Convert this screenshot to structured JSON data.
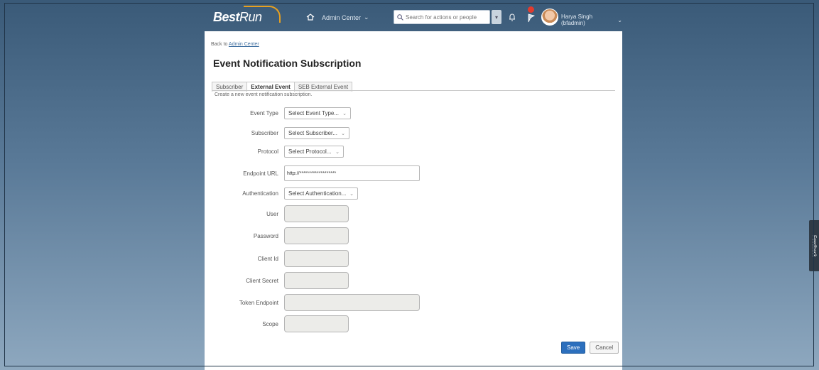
{
  "colors": {
    "primary_button": "#2c6fbd",
    "notification_badge": "#e23b2e",
    "logo_accent": "#e6a020"
  },
  "shell": {
    "logo_best": "Best",
    "logo_run": "Run",
    "nav_label": "Admin Center",
    "search_placeholder": "Search for actions or people",
    "user_name": "Harya Singh (bfadmin)"
  },
  "breadcrumb": {
    "prefix": "Back to",
    "link": "Admin Center"
  },
  "page": {
    "title": "Event Notification Subscription"
  },
  "tabs": [
    {
      "label": "Subscriber"
    },
    {
      "label": "External Event"
    },
    {
      "label": "SEB External Event"
    }
  ],
  "helper_text": "Create a new event notification subscription.",
  "form": {
    "event_type": {
      "label": "Event Type",
      "value": "Select Event Type..."
    },
    "subscriber": {
      "label": "Subscriber",
      "value": "Select Subscriber..."
    },
    "protocol": {
      "label": "Protocol",
      "value": "Select Protocol..."
    },
    "endpoint_url": {
      "label": "Endpoint URL",
      "value": "http://*******************"
    },
    "authentication": {
      "label": "Authentication",
      "value": "Select Authentication..."
    },
    "user": {
      "label": "User"
    },
    "password": {
      "label": "Password"
    },
    "client_id": {
      "label": "Client Id"
    },
    "client_secret": {
      "label": "Client Secret"
    },
    "token_endpoint": {
      "label": "Token Endpoint"
    },
    "scope": {
      "label": "Scope"
    }
  },
  "actions": {
    "save": "Save",
    "cancel": "Cancel"
  },
  "feedback": "Feedback"
}
